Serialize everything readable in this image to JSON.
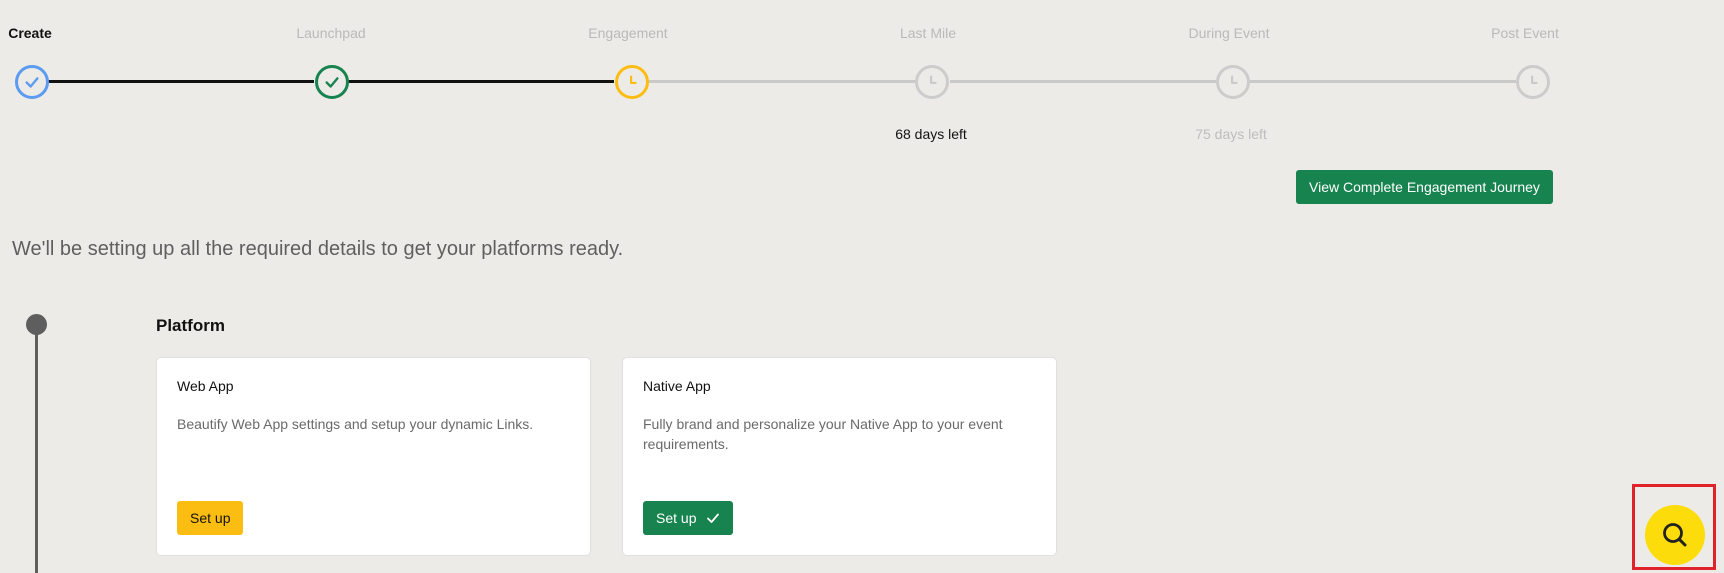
{
  "stepper": {
    "steps": [
      {
        "label": "Create",
        "status": "done",
        "color": "#5b9bf0"
      },
      {
        "label": "Launchpad",
        "status": "done",
        "color": "#17834f"
      },
      {
        "label": "Engagement",
        "status": "current",
        "color": "#fbbd12"
      },
      {
        "label": "Last Mile",
        "status": "pending",
        "color": "#c9c9c9",
        "days_left": "68 days left"
      },
      {
        "label": "During Event",
        "status": "pending",
        "color": "#c9c9c9",
        "days_left": "75 days left"
      },
      {
        "label": "Post Event",
        "status": "pending",
        "color": "#c9c9c9"
      }
    ]
  },
  "journey_button": {
    "label": "View Complete Engagement Journey"
  },
  "intro_text": "We'll be setting up all the required details to get your platforms ready.",
  "platform": {
    "title": "Platform",
    "cards": [
      {
        "title": "Web App",
        "description": "Beautify Web App settings and setup your dynamic Links.",
        "button_label": "Set up"
      },
      {
        "title": "Native App",
        "description": "Fully brand and personalize your Native App to your event requirements.",
        "button_label": "Set up"
      }
    ]
  },
  "fab": {
    "icon": "search-icon"
  },
  "colors": {
    "background": "#edebe7",
    "primary_green": "#17834f",
    "accent_yellow": "#fbbd12",
    "fab_yellow": "#fcdc0a",
    "highlight_red": "#e0222a"
  }
}
